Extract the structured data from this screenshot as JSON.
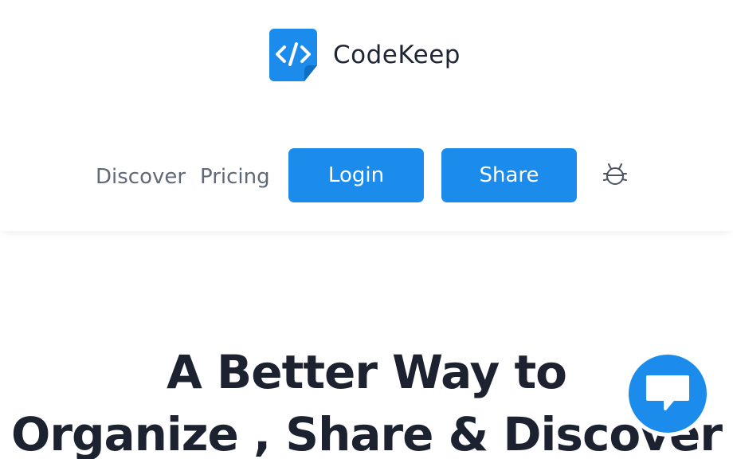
{
  "brand": {
    "name": "CodeKeep",
    "logo_icon": "code-brackets-icon",
    "accent_color": "#1b8ceb"
  },
  "nav": {
    "discover": "Discover",
    "pricing": "Pricing",
    "login": "Login",
    "share": "Share",
    "bug_icon": "bug-icon"
  },
  "hero": {
    "line1": "A Better Way to",
    "line2": "Organize , Share & Discover"
  },
  "chat": {
    "icon": "chat-bubble-icon"
  }
}
